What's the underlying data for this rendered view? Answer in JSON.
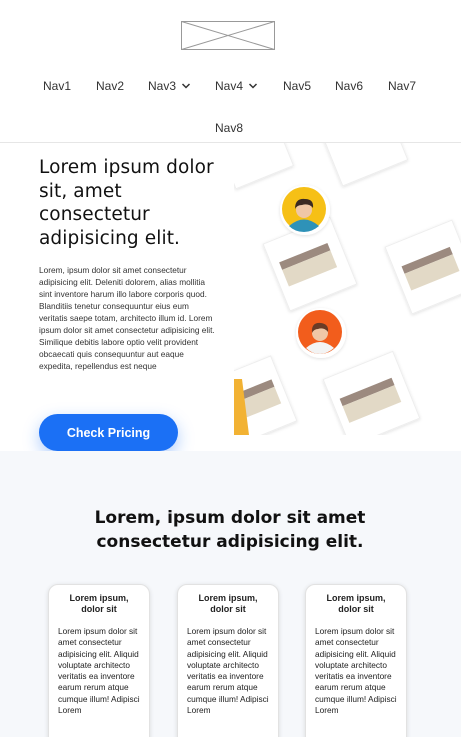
{
  "header": {
    "nav": [
      {
        "label": "Nav1",
        "has_dropdown": false
      },
      {
        "label": "Nav2",
        "has_dropdown": false
      },
      {
        "label": "Nav3",
        "has_dropdown": true
      },
      {
        "label": "Nav4",
        "has_dropdown": true
      },
      {
        "label": "Nav5",
        "has_dropdown": false
      },
      {
        "label": "Nav6",
        "has_dropdown": false
      },
      {
        "label": "Nav7",
        "has_dropdown": false
      },
      {
        "label": "Nav8",
        "has_dropdown": false
      }
    ]
  },
  "hero": {
    "title": "Lorem ipsum dolor sit, amet consectetur adipisicing elit.",
    "body": "Lorem, ipsum dolor sit amet consectetur adipisicing elit. Deleniti dolorem, alias mollitia sint inventore harum illo labore corporis quod. Blanditiis tenetur consequuntur eius eum veritatis saepe totam, architecto illum id. Lorem ipsum dolor sit amet consectetur adipisicing elit. Similique debitis labore optio velit provident obcaecati quis consequuntur aut eaque expedita, repellendus est neque",
    "cta_label": "Check Pricing"
  },
  "features": {
    "title": "Lorem, ipsum dolor sit amet consectetur adipisicing elit.",
    "cards": [
      {
        "title": "Lorem ipsum, dolor sit",
        "text": "Lorem ipsum dolor sit amet consectetur adipisicing elit. Aliquid voluptate architecto veritatis ea inventore earum rerum atque cumque illum! Adipisci Lorem"
      },
      {
        "title": "Lorem ipsum, dolor sit",
        "text": "Lorem ipsum dolor sit amet consectetur adipisicing elit. Aliquid voluptate architecto veritatis ea inventore earum rerum atque cumque illum! Adipisci Lorem"
      },
      {
        "title": "Lorem ipsum, dolor sit",
        "text": "Lorem ipsum dolor sit amet consectetur adipisicing elit. Aliquid voluptate architecto veritatis ea inventore earum rerum atque cumque illum! Adipisci Lorem"
      }
    ]
  },
  "colors": {
    "accent": "#1b70f5",
    "section_bg": "#f6f8fb"
  },
  "icons": {
    "logo": "logo-placeholder-icon",
    "dropdown": "chevron-down-icon"
  }
}
